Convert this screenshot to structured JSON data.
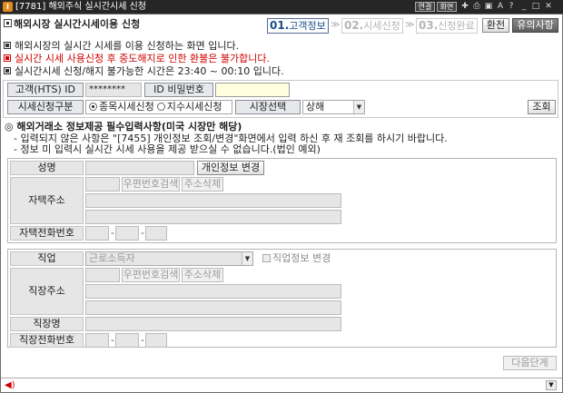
{
  "window": {
    "screen_no": "[7781]",
    "title": "해외주식 실시간시세 신청",
    "tb_btn1": "연결",
    "tb_btn2": "화면"
  },
  "header": {
    "title": "해외시장 실시간시세이용 신청",
    "steps": [
      {
        "num": "01.",
        "label": "고객정보"
      },
      {
        "num": "02.",
        "label": "시세신청"
      },
      {
        "num": "03.",
        "label": "신청완료"
      }
    ],
    "btn_convert": "환전",
    "btn_notice": "유의사항"
  },
  "notices": [
    "해외시장의 실시간 시세를 이용 신청하는 화면 입니다.",
    "실시간 시세 사용신청 후 중도해지로 인한 환불은 불가합니다.",
    "실시간시세 신청/해지 불가능한 시간은 23:40 ~ 00:10 입니다."
  ],
  "form": {
    "customer_id_label": "고객(HTS) ID",
    "customer_id_value": "********",
    "password_label": "ID 비밀번호",
    "password_value": "",
    "apply_type_label": "시세신청구분",
    "radio_stock": "종목시세신청",
    "radio_index": "지수시세신청",
    "market_label": "시장선택",
    "market_value": "상해",
    "query_button": "조회"
  },
  "required": {
    "heading": "◎ 해외거래소 정보제공 필수입력사항(미국 시장만 해당)",
    "line1": "- 입력되지 않은 사항은 \"[7455] 개인정보 조회/변경\"화면에서 입력 하신 후 재 조회를 하시기 바랍니다.",
    "line2": "- 정보 미 입력시 실시간 시세 사용을 제공 받으실 수 없습니다.(법인 예외)"
  },
  "personal": {
    "name_label": "성명",
    "change_personal_btn": "개인정보 변경",
    "home_addr_label": "자택주소",
    "zip_search_btn": "우편번호검색",
    "addr_delete_btn": "주소삭제",
    "home_phone_label": "자택전화번호",
    "dash": "-"
  },
  "job": {
    "job_label": "직업",
    "job_value": "근로소득자",
    "change_job_label": "직업정보 변경",
    "work_addr_label": "직장주소",
    "zip_search_btn": "우편번호검색",
    "addr_delete_btn": "주소삭제",
    "company_label": "직장명",
    "work_phone_label": "직장전화번호",
    "dash": "-"
  },
  "footer": {
    "next_button": "다음단계"
  }
}
